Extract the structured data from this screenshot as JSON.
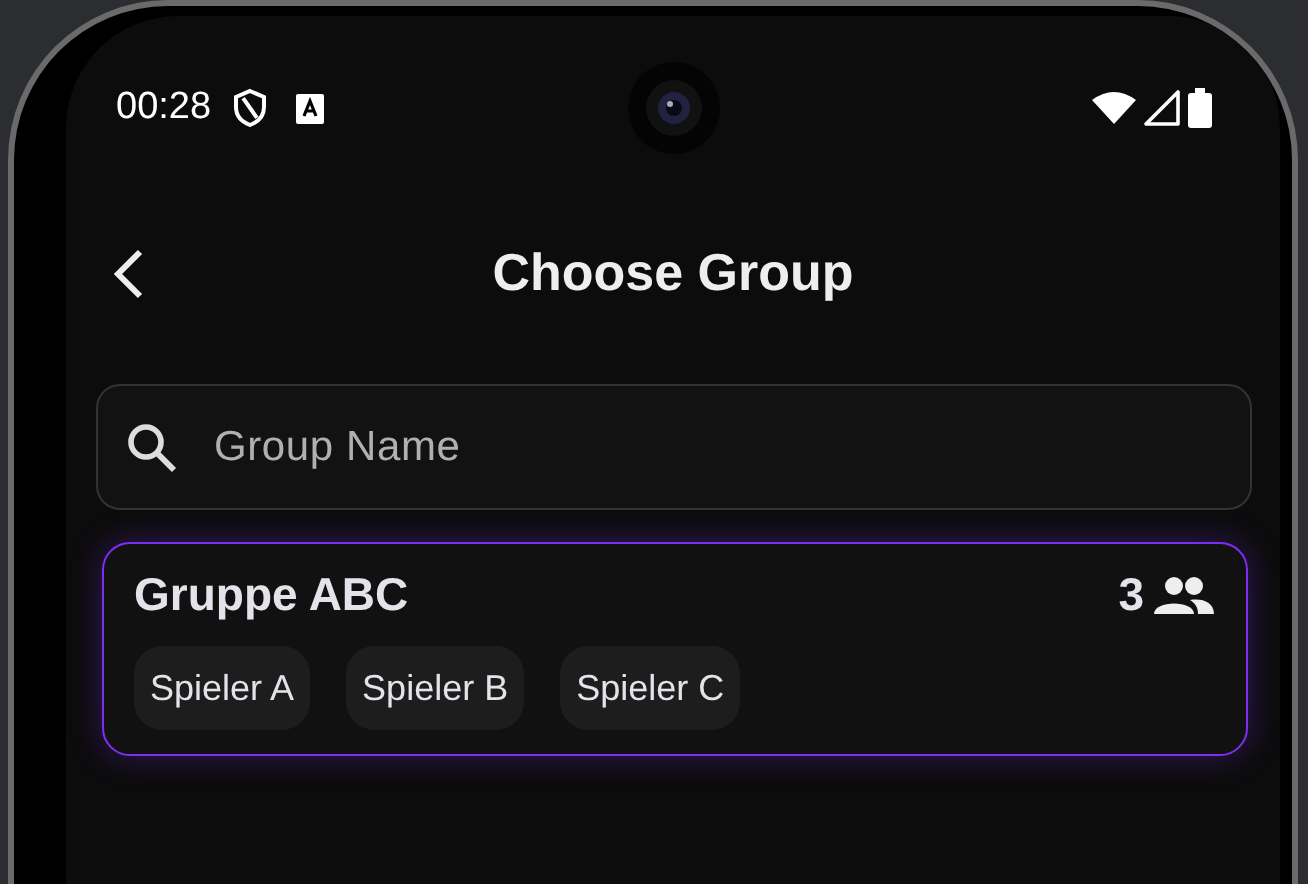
{
  "status_bar": {
    "time": "00:28"
  },
  "header": {
    "title": "Choose Group"
  },
  "search": {
    "placeholder": "Group Name"
  },
  "groups": [
    {
      "name": "Gruppe ABC",
      "member_count": "3",
      "selected": true,
      "members": [
        "Spieler A",
        "Spieler B",
        "Spieler C"
      ]
    }
  ]
}
